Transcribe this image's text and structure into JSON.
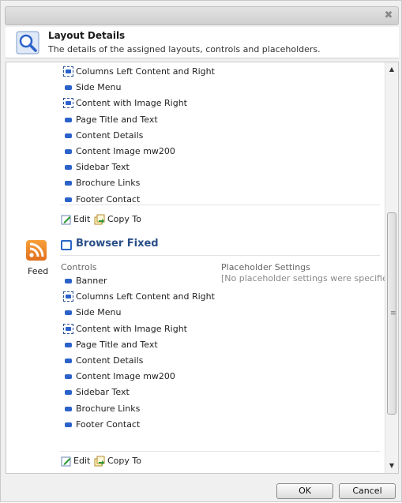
{
  "header": {
    "title": "Layout Details",
    "subtitle": "The details of the assigned layouts, controls and placeholders."
  },
  "top_list": [
    {
      "label": "Columns Left Content and Right",
      "selected": true
    },
    {
      "label": "Side Menu",
      "selected": false
    },
    {
      "label": "Content with Image Right",
      "selected": true
    },
    {
      "label": "Page Title and Text",
      "selected": false
    },
    {
      "label": "Content Details",
      "selected": false
    },
    {
      "label": "Content Image mw200",
      "selected": false
    },
    {
      "label": "Sidebar Text",
      "selected": false
    },
    {
      "label": "Brochure Links",
      "selected": false
    },
    {
      "label": "Footer Contact",
      "selected": false
    }
  ],
  "actions": {
    "edit": "Edit",
    "copy_to": "Copy To"
  },
  "feed": {
    "label": "Feed"
  },
  "layout": {
    "title": "Browser Fixed",
    "controls_heading": "Controls",
    "placeholder_heading": "Placeholder Settings",
    "placeholder_note": "[No placeholder settings were specified]",
    "controls": [
      {
        "label": "Banner",
        "selected": false
      },
      {
        "label": "Columns Left Content and Right",
        "selected": true
      },
      {
        "label": "Side Menu",
        "selected": false
      },
      {
        "label": "Content with Image Right",
        "selected": true
      },
      {
        "label": "Page Title and Text",
        "selected": false
      },
      {
        "label": "Content Details",
        "selected": false
      },
      {
        "label": "Content Image mw200",
        "selected": false
      },
      {
        "label": "Sidebar Text",
        "selected": false
      },
      {
        "label": "Brochure Links",
        "selected": false
      },
      {
        "label": "Footer Contact",
        "selected": false
      }
    ]
  },
  "buttons": {
    "ok": "OK",
    "cancel": "Cancel"
  },
  "icons": {
    "close": "close-icon",
    "search": "magnifier-icon",
    "feed": "rss-feed-icon",
    "control": "control-bullet-icon",
    "edit": "edit-icon",
    "copy": "copy-to-icon",
    "layout": "layout-box-icon"
  },
  "colors": {
    "accent": "#2a4f88",
    "bullet": "#2b62c9",
    "feed": "#f08a24"
  }
}
